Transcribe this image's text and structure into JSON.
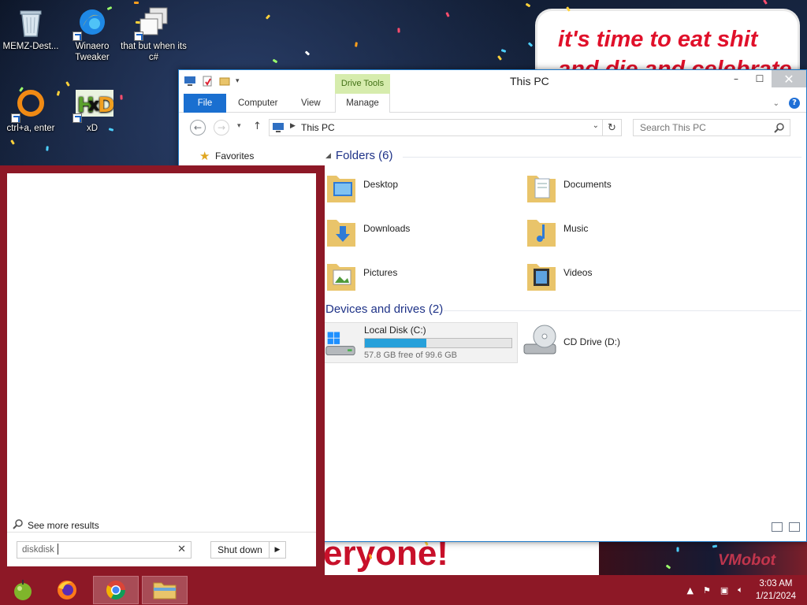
{
  "desktop": {
    "icons": [
      {
        "label": "MEMZ-Dest...",
        "icon": "recycle-bin-icon"
      },
      {
        "label": "Winaero Tweaker",
        "icon": "winaero-tweaker-icon"
      },
      {
        "label": "that but when its c#",
        "icon": "stacked-windows-icon"
      },
      {
        "label": "ctrl+a, enter",
        "icon": "orange-ring-icon"
      },
      {
        "label": "xD",
        "icon": "hxd-icon"
      }
    ],
    "wallpaper_text_top": "it's time to eat shit",
    "wallpaper_text_top_2": "and die and celebrate",
    "wallpaper_text_bottom": "eryone!",
    "wallpaper_text_strip": "VMobot"
  },
  "explorer": {
    "title": "This PC",
    "contextual_tab": "Drive Tools",
    "tabs": [
      "File",
      "Computer",
      "View",
      "Manage"
    ],
    "help": "?",
    "address_path": "This PC",
    "search_placeholder": "Search This PC",
    "nav_favorites": "Favorites",
    "folders_header": "Folders (6)",
    "folders": [
      "Desktop",
      "Documents",
      "Downloads",
      "Music",
      "Pictures",
      "Videos"
    ],
    "devices_header": "Devices and drives (2)",
    "drives": [
      {
        "name": "Local Disk (C:)",
        "free": "57.8 GB free of 99.6 GB",
        "used_fraction": 0.42
      },
      {
        "name": "CD Drive (D:)"
      }
    ]
  },
  "start_panel": {
    "see_more": "See more results",
    "search_value": "diskdisk",
    "shutdown_label": "Shut down",
    "shutdown_arrow": "▶"
  },
  "taskbar": {
    "apps": [
      "app-icon",
      "firefox-icon",
      "chrome-icon",
      "file-explorer-icon"
    ],
    "time": "3:03 AM",
    "date": "1/21/2024"
  },
  "colors": {
    "accent": "#8d1826",
    "ribbon_file": "#1a6fd0",
    "drive_bar": "#26a0da",
    "group_header": "#1e3287"
  }
}
